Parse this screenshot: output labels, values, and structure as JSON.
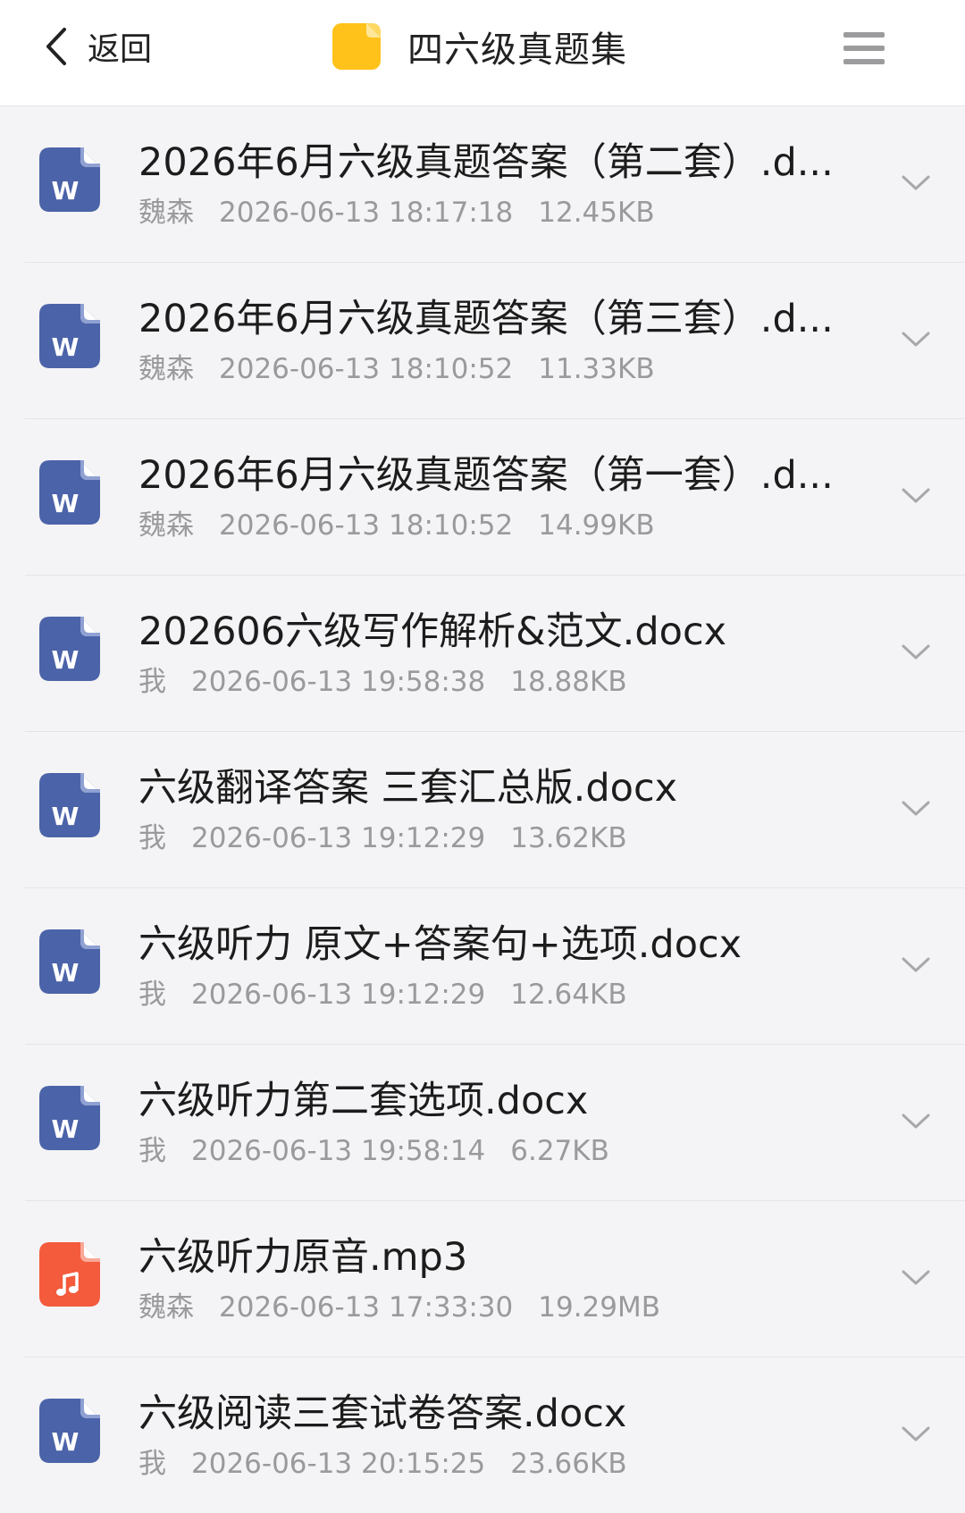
{
  "header": {
    "back_label": "返回",
    "title": "四六级真题集"
  },
  "colors": {
    "word_icon": "#4b63a8",
    "audio_icon": "#f45a3c",
    "folder": "#ffc21a"
  },
  "files": [
    {
      "name": "2026年6月六级真题答案（第二套）.d...",
      "owner": "魏森",
      "time": "2026-06-13 18:17:18",
      "size": "12.45KB",
      "type": "word-icon"
    },
    {
      "name": "2026年6月六级真题答案（第三套）.d...",
      "owner": "魏森",
      "time": "2026-06-13 18:10:52",
      "size": "11.33KB",
      "type": "word-icon"
    },
    {
      "name": "2026年6月六级真题答案（第一套）.d...",
      "owner": "魏森",
      "time": "2026-06-13 18:10:52",
      "size": "14.99KB",
      "type": "word-icon"
    },
    {
      "name": "202606六级写作解析&范文.docx",
      "owner": "我",
      "time": "2026-06-13 19:58:38",
      "size": "18.88KB",
      "type": "word-icon"
    },
    {
      "name": "六级翻译答案 三套汇总版.docx",
      "owner": "我",
      "time": "2026-06-13 19:12:29",
      "size": "13.62KB",
      "type": "word-icon"
    },
    {
      "name": "六级听力 原文+答案句+选项.docx",
      "owner": "我",
      "time": "2026-06-13 19:12:29",
      "size": "12.64KB",
      "type": "word-icon"
    },
    {
      "name": "六级听力第二套选项.docx",
      "owner": "我",
      "time": "2026-06-13 19:58:14",
      "size": "6.27KB",
      "type": "word-icon"
    },
    {
      "name": "六级听力原音.mp3",
      "owner": "魏森",
      "time": "2026-06-13 17:33:30",
      "size": "19.29MB",
      "type": "audio-icon"
    },
    {
      "name": "六级阅读三套试卷答案.docx",
      "owner": "我",
      "time": "2026-06-13 20:15:25",
      "size": "23.66KB",
      "type": "word-icon"
    }
  ]
}
